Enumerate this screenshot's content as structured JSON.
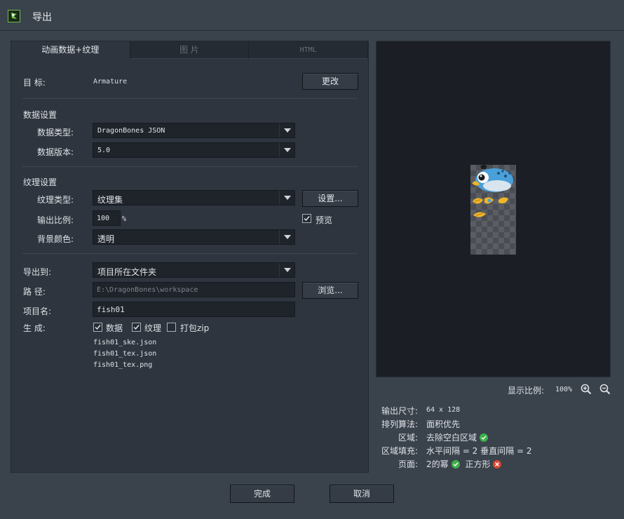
{
  "window": {
    "title": "导出",
    "app_icon": "dragonbones-logo-icon"
  },
  "tabs": [
    {
      "label": "动画数据+纹理",
      "active": true
    },
    {
      "label": "图 片",
      "active": false
    },
    {
      "label": "HTML",
      "active": false
    }
  ],
  "target": {
    "label": "目  标:",
    "value": "Armature",
    "change_button": "更改"
  },
  "data_settings": {
    "heading": "数据设置",
    "type_label": "数据类型:",
    "type_value": "DragonBones JSON",
    "version_label": "数据版本:",
    "version_value": "5.0"
  },
  "texture_settings": {
    "heading": "纹理设置",
    "type_label": "纹理类型:",
    "type_value": "纹理集",
    "settings_button": "设置...",
    "scale_label": "输出比例:",
    "scale_value": "100",
    "scale_unit": "%",
    "preview_label": "预览",
    "preview_checked": true,
    "bg_label": "背景颜色:",
    "bg_value": "透明"
  },
  "export": {
    "to_label": "导出到:",
    "to_value": "项目所在文件夹",
    "path_label": "路  径:",
    "path_value": "E:\\DragonBones\\workspace",
    "browse_button": "浏览...",
    "name_label": "项目名:",
    "name_value": "fish01",
    "generate_label": "生  成:",
    "options": [
      {
        "label": "数据",
        "checked": true
      },
      {
        "label": "纹理",
        "checked": true
      },
      {
        "label": "打包zip",
        "checked": false
      }
    ],
    "files": [
      "fish01_ske.json",
      "fish01_tex.json",
      "fish01_tex.png"
    ]
  },
  "preview": {
    "zoom_label": "显示比例:",
    "zoom_value": "100%",
    "zoom_in_icon": "zoom-in-icon",
    "zoom_out_icon": "zoom-out-icon"
  },
  "info": {
    "size_label": "输出尺寸:",
    "size_value": "64 x 128",
    "algo_label": "排列算法:",
    "algo_value": "面积优先",
    "region_label": "区域:",
    "region_value": "去除空白区域",
    "padding_label": "区域填充:",
    "padding_value": "水平间隔 = 2 垂直间隔 = 2",
    "page_label": "页面:",
    "page_value": "2的幂",
    "page_square": "正方形"
  },
  "buttons": {
    "done": "完成",
    "cancel": "取消"
  },
  "colors": {
    "ok": "#3fb04a",
    "bad": "#d9452e",
    "fish_blue": "#4aa0d8",
    "fish_yellow": "#f0b428"
  }
}
